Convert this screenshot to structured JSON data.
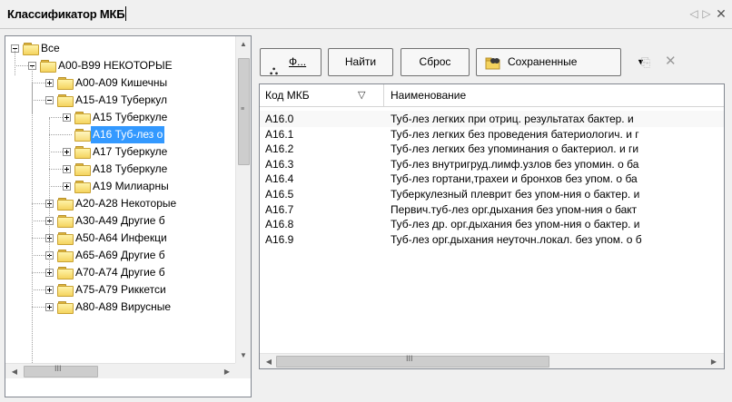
{
  "window": {
    "title": "Классификатор МКБ",
    "nav_left_icon": "triangle-left-icon",
    "nav_right_icon": "triangle-right-icon",
    "close_glyph": "✕"
  },
  "tree": {
    "items": [
      {
        "label": "Все",
        "level": 0,
        "expander": "minus",
        "open": false
      },
      {
        "label": "A00-B99 НЕКОТОРЫЕ",
        "level": 1,
        "expander": "minus",
        "open": false
      },
      {
        "label": "A00-A09 Кишечны",
        "level": 2,
        "expander": "plus",
        "open": false
      },
      {
        "label": "A15-A19 Туберкул",
        "level": 2,
        "expander": "minus",
        "open": false
      },
      {
        "label": "A15 Туберкуле",
        "level": 3,
        "expander": "plus",
        "open": false
      },
      {
        "label": "A16 Туб-лез о",
        "level": 3,
        "expander": "none",
        "open": true,
        "selected": true
      },
      {
        "label": "A17 Туберкуле",
        "level": 3,
        "expander": "plus",
        "open": false
      },
      {
        "label": "A18 Туберкуле",
        "level": 3,
        "expander": "plus",
        "open": false
      },
      {
        "label": "A19 Милиарны",
        "level": 3,
        "expander": "plus",
        "open": false
      },
      {
        "label": "A20-A28 Некоторые",
        "level": 2,
        "expander": "plus",
        "open": false
      },
      {
        "label": "A30-A49 Другие б",
        "level": 2,
        "expander": "plus",
        "open": false
      },
      {
        "label": "A50-A64 Инфекци",
        "level": 2,
        "expander": "plus",
        "open": false
      },
      {
        "label": "A65-A69 Другие б",
        "level": 2,
        "expander": "plus",
        "open": false
      },
      {
        "label": "A70-A74 Другие б",
        "level": 2,
        "expander": "plus",
        "open": false
      },
      {
        "label": "A75-A79 Риккетси",
        "level": 2,
        "expander": "plus",
        "open": false
      },
      {
        "label": "A80-A89 Вирусные",
        "level": 2,
        "expander": "plus",
        "open": false
      }
    ],
    "hscroll_grip": "III"
  },
  "toolbar": {
    "find_icon_label": "Ф...",
    "find_label": "Найти",
    "reset_label": "Сброс",
    "saved_label": "Сохраненные",
    "dropdown_glyph": "▼"
  },
  "grid": {
    "col_code": "Код МКБ",
    "col_name": "Наименование",
    "rows": [
      {
        "code": "A16.0",
        "name": "Туб-лез легких при отриц. результатах бактер. и"
      },
      {
        "code": "A16.1",
        "name": "Туб-лез легких без проведения батериологич. и г"
      },
      {
        "code": "A16.2",
        "name": "Туб-лез легких без упоминания о бактериол. и ги"
      },
      {
        "code": "A16.3",
        "name": "Туб-лез внутригруд.лимф.узлов без упомин. о ба"
      },
      {
        "code": "A16.4",
        "name": "Туб-лез гортани,трахеи и бронхов без упом. о ба"
      },
      {
        "code": "A16.5",
        "name": "Туберкулезный плеврит без упом-ния о бактер. и"
      },
      {
        "code": "A16.7",
        "name": "Первич.туб-лез орг.дыхания без упом-ния о бакт"
      },
      {
        "code": "A16.8",
        "name": "Туб-лез др. орг.дыхания без упом-ния о бактер. и"
      },
      {
        "code": "A16.9",
        "name": "Туб-лез орг.дыхания неуточн.локал. без упом. о б"
      }
    ],
    "hscroll_grip": "III"
  },
  "colors": {
    "selection": "#3399ff",
    "folder": "#f4d35e",
    "border": "#828790"
  }
}
